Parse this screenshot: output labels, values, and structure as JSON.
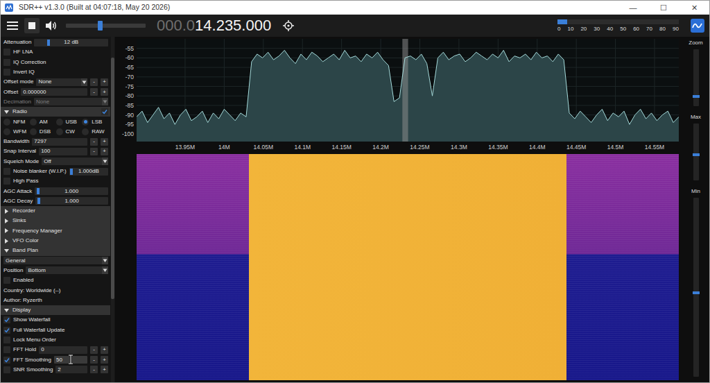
{
  "window": {
    "title": "SDR++ v1.3.0 (Built at 04:07:18, May 20 2026)",
    "controls": [
      "—",
      "☐",
      "✕"
    ]
  },
  "toolbar": {
    "running": true,
    "muted": false,
    "volume": {
      "level": 0.43
    },
    "frequency": [
      {
        "text": "000.0",
        "dim": true
      },
      {
        "text": "14.235.000",
        "dim": false
      }
    ],
    "snr_meter": {
      "level": 0.08,
      "ticks": [
        "0",
        "10",
        "20",
        "30",
        "40",
        "50",
        "60",
        "70",
        "80",
        "90"
      ]
    }
  },
  "sidebar": {
    "scrollbar": {
      "level": 0.7,
      "position": 0.2
    },
    "items": [
      {
        "kind": "slider",
        "label": "Attenuation",
        "level": 0.18,
        "reading": "12 dB"
      },
      {
        "kind": "checkbox",
        "label": "HF LNA",
        "checked": false
      },
      {
        "kind": "checkbox",
        "label": "IQ Correction",
        "checked": false
      },
      {
        "kind": "checkbox",
        "label": "Invert IQ",
        "checked": false
      },
      {
        "kind": "select",
        "label": "Offset mode",
        "value": "None",
        "disabled": false,
        "buttons": [
          "-",
          "+"
        ]
      },
      {
        "kind": "input",
        "label": "Offset",
        "value": "0.000000",
        "buttons": [
          "-",
          "+"
        ]
      },
      {
        "kind": "select",
        "label": "Decimation",
        "value": "None",
        "disabled": true,
        "buttons": []
      },
      {
        "kind": "header",
        "label": "Radio",
        "expanded": true,
        "enabled": true
      },
      {
        "kind": "radios",
        "options": [
          {
            "label": "NFM",
            "selected": false
          },
          {
            "label": "AM",
            "selected": false
          },
          {
            "label": "USB",
            "selected": false
          },
          {
            "label": "LSB",
            "selected": true
          },
          {
            "label": "WFM",
            "selected": false
          },
          {
            "label": "DSB",
            "selected": false
          },
          {
            "label": "CW",
            "selected": false
          },
          {
            "label": "RAW",
            "selected": false
          }
        ]
      },
      {
        "kind": "input",
        "label": "Bandwidth",
        "value": "7297",
        "buttons": [
          "-",
          "+"
        ]
      },
      {
        "kind": "input",
        "label": "Snap Interval",
        "value": "100",
        "buttons": [
          "-",
          "+"
        ]
      },
      {
        "kind": "select",
        "label": "Squelch Mode",
        "value": "Off",
        "disabled": false,
        "buttons": []
      },
      {
        "kind": "checkslider",
        "label": "Noise blanker (W.I.P.)",
        "checked": false,
        "level": 0.02,
        "reading": "1.000dB"
      },
      {
        "kind": "checkbox",
        "label": "High Pass",
        "checked": false
      },
      {
        "kind": "slider",
        "label": "AGC Attack",
        "level": 0.03,
        "reading": "1.000"
      },
      {
        "kind": "slider",
        "label": "AGC Decay",
        "level": 0.03,
        "reading": "1.000"
      },
      {
        "kind": "header",
        "label": "Recorder",
        "expanded": false
      },
      {
        "kind": "header",
        "label": "Sinks",
        "expanded": false
      },
      {
        "kind": "header",
        "label": "Frequency Manager",
        "expanded": false
      },
      {
        "kind": "header",
        "label": "VFO Color",
        "expanded": false
      },
      {
        "kind": "header",
        "label": "Band Plan",
        "expanded": true
      },
      {
        "kind": "select",
        "value": "General",
        "disabled": false,
        "buttons": []
      },
      {
        "kind": "select",
        "label": "Position",
        "value": "Bottom",
        "disabled": false,
        "buttons": []
      },
      {
        "kind": "checkbox",
        "label": "Enabled",
        "checked": false
      },
      {
        "kind": "text",
        "label": "Country: Worldwide (--)"
      },
      {
        "kind": "text",
        "label": "Author: Ryzerth"
      },
      {
        "kind": "header",
        "label": "Display",
        "expanded": true
      },
      {
        "kind": "checkbox",
        "label": "Show Waterfall",
        "checked": true
      },
      {
        "kind": "checkbox",
        "label": "Full Waterfall Update",
        "checked": true
      },
      {
        "kind": "checkbox",
        "label": "Lock Menu Order",
        "checked": false
      },
      {
        "kind": "checkinput",
        "label": "FFT Hold",
        "checked": false,
        "value": "0",
        "buttons": [
          "-",
          "+"
        ],
        "hovered": false
      },
      {
        "kind": "checkinput",
        "label": "FFT Smoothing",
        "checked": true,
        "value": "50",
        "buttons": [
          "-",
          "+"
        ],
        "hovered": true
      },
      {
        "kind": "checkinput",
        "label": "SNR Smoothing",
        "checked": false,
        "value": "2",
        "buttons": [
          "-",
          "+"
        ],
        "hovered": false
      }
    ]
  },
  "fft": {
    "start_mhz": 13.888,
    "end_mhz": 14.581,
    "db_top": -50,
    "db_bottom": -104,
    "y_ticks": [
      {
        "label": "-55",
        "db": -55
      },
      {
        "label": "-60",
        "db": -60
      },
      {
        "label": "-65",
        "db": -65
      },
      {
        "label": "-70",
        "db": -70
      },
      {
        "label": "-75",
        "db": -75
      },
      {
        "label": "-80",
        "db": -80
      },
      {
        "label": "-85",
        "db": -85
      },
      {
        "label": "-90",
        "db": -90
      },
      {
        "label": "-95",
        "db": -95
      },
      {
        "label": "-100",
        "db": -100
      }
    ],
    "x_ticks": [
      {
        "label": "13.95M",
        "mhz": 13.95
      },
      {
        "label": "14M",
        "mhz": 14.0
      },
      {
        "label": "14.05M",
        "mhz": 14.05
      },
      {
        "label": "14.1M",
        "mhz": 14.1
      },
      {
        "label": "14.15M",
        "mhz": 14.15
      },
      {
        "label": "14.2M",
        "mhz": 14.2
      },
      {
        "label": "14.25M",
        "mhz": 14.25
      },
      {
        "label": "14.3M",
        "mhz": 14.3
      },
      {
        "label": "14.35M",
        "mhz": 14.35
      },
      {
        "label": "14.4M",
        "mhz": 14.4
      },
      {
        "label": "14.45M",
        "mhz": 14.45
      },
      {
        "label": "14.5M",
        "mhz": 14.5
      },
      {
        "label": "14.55M",
        "mhz": 14.55
      }
    ],
    "vfo": {
      "low_mhz": 14.2277,
      "high_mhz": 14.235
    },
    "series": [
      -91,
      -88,
      -94,
      -90,
      -86,
      -92,
      -89,
      -95,
      -90,
      -87,
      -93,
      -91,
      -88,
      -94,
      -89,
      -92,
      -87,
      -90,
      -93,
      -89,
      -91,
      -62,
      -58,
      -60,
      -57,
      -61,
      -59,
      -56,
      -60,
      -63,
      -58,
      -61,
      -57,
      -59,
      -62,
      -60,
      -58,
      -61,
      -56,
      -60,
      -59,
      -62,
      -58,
      -60,
      -57,
      -61,
      -64,
      -83,
      -81,
      -60,
      -59,
      -61,
      -58,
      -63,
      -80,
      -60,
      -57,
      -61,
      -59,
      -58,
      -62,
      -60,
      -57,
      -59,
      -61,
      -58,
      -60,
      -56,
      -62,
      -59,
      -60,
      -58,
      -61,
      -57,
      -60,
      -59,
      -62,
      -58,
      -61,
      -89,
      -92,
      -88,
      -91,
      -94,
      -90,
      -87,
      -93,
      -89,
      -91,
      -88,
      -95,
      -90,
      -87,
      -92,
      -89,
      -93,
      -90,
      -88,
      -94,
      -91
    ]
  },
  "side_sliders": [
    {
      "label": "Zoom",
      "level": 0.15
    },
    {
      "label": "Max",
      "level": 0.45
    },
    {
      "label": "Min",
      "level": 0.47
    }
  ]
}
